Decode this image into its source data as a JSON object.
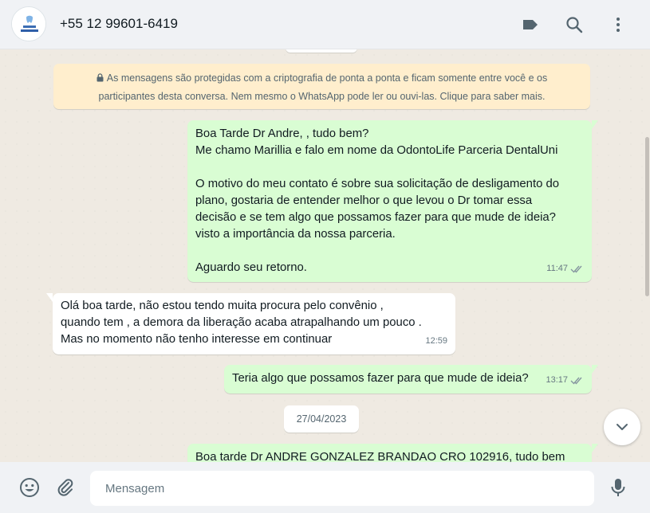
{
  "header": {
    "contact_name": "+55 12 99601-6419",
    "avatar_icon": "tooth-logo-icon",
    "icons": [
      "label-icon",
      "search-icon",
      "more-vert-icon"
    ]
  },
  "encryption_notice": {
    "line1": "As mensagens são protegidas com a criptografia de ponta a ponta e ficam somente entre você e os",
    "line2": "participantes desta conversa. Nem mesmo o WhatsApp pode ler ou ouvi-las. Clique para saber mais.",
    "icon": "lock-icon"
  },
  "messages": [
    {
      "direction": "out",
      "text": "Boa Tarde Dr Andre, , tudo bem?\nMe chamo Marillia e falo em nome da OdontoLife Parceria DentalUni\n\nO motivo do meu contato é sobre sua solicitação de desligamento do\nplano, gostaria de entender melhor o que levou o Dr tomar essa\ndecisão e se tem algo que possamos fazer para que mude de ideia?\nvisto a importância da nossa parceria.\n\nAguardo seu retorno.",
      "time": "11:47",
      "status_icon": "double-check-icon"
    },
    {
      "direction": "in",
      "text": "Olá boa tarde,  não estou tendo muita procura pelo convênio  ,\nquando tem , a demora da liberação acaba atrapalhando um pouco .\n Mas no momento não tenho interesse em continuar",
      "time": "12:59"
    },
    {
      "direction": "out",
      "text": "Teria algo que possamos fazer para que mude de ideia?",
      "time": "13:17",
      "status_icon": "double-check-icon"
    },
    {
      "direction": "out",
      "text": "Boa tarde Dr ANDRE GONZALEZ BRANDAO CRO 102916, tudo bem"
    }
  ],
  "date_divider": "27/04/2023",
  "composer": {
    "placeholder": "Mensagem",
    "icons": [
      "emoji-icon",
      "attach-icon",
      "mic-icon"
    ]
  },
  "colors": {
    "outgoing_bubble": "#d9fdd3",
    "incoming_bubble": "#ffffff",
    "notice_bg": "#ffeecd",
    "chat_bg": "#efeae2",
    "check_blue": "#53bdeb"
  }
}
